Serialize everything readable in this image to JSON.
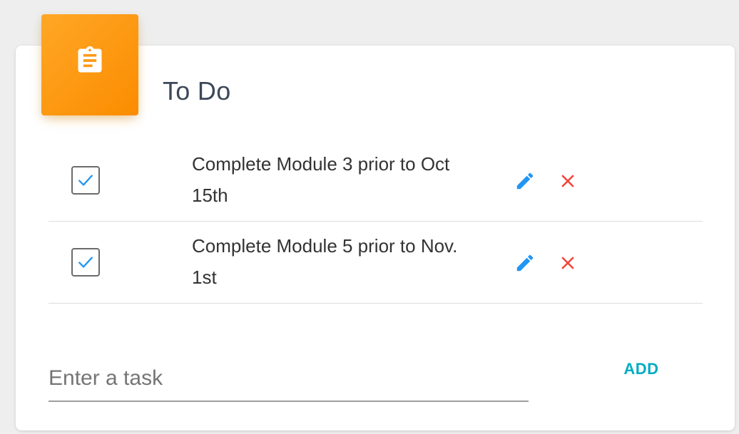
{
  "card": {
    "title": "To Do",
    "header_icon": "clipboard-icon"
  },
  "tasks": [
    {
      "text": "Complete Module 3 prior to Oct 15th",
      "checked": true,
      "edit_icon": "pencil-icon",
      "delete_icon": "close-icon"
    },
    {
      "text": "Complete Module 5 prior to Nov. 1st",
      "checked": true,
      "edit_icon": "pencil-icon",
      "delete_icon": "close-icon"
    }
  ],
  "new_task": {
    "value": "",
    "placeholder": "Enter a task"
  },
  "add_button": {
    "label": "ADD"
  },
  "colors": {
    "accent_orange": "#fb8c00",
    "check_blue": "#2196f3",
    "edit_blue": "#2196f3",
    "delete_red": "#f44336",
    "add_teal": "#00acc1"
  }
}
